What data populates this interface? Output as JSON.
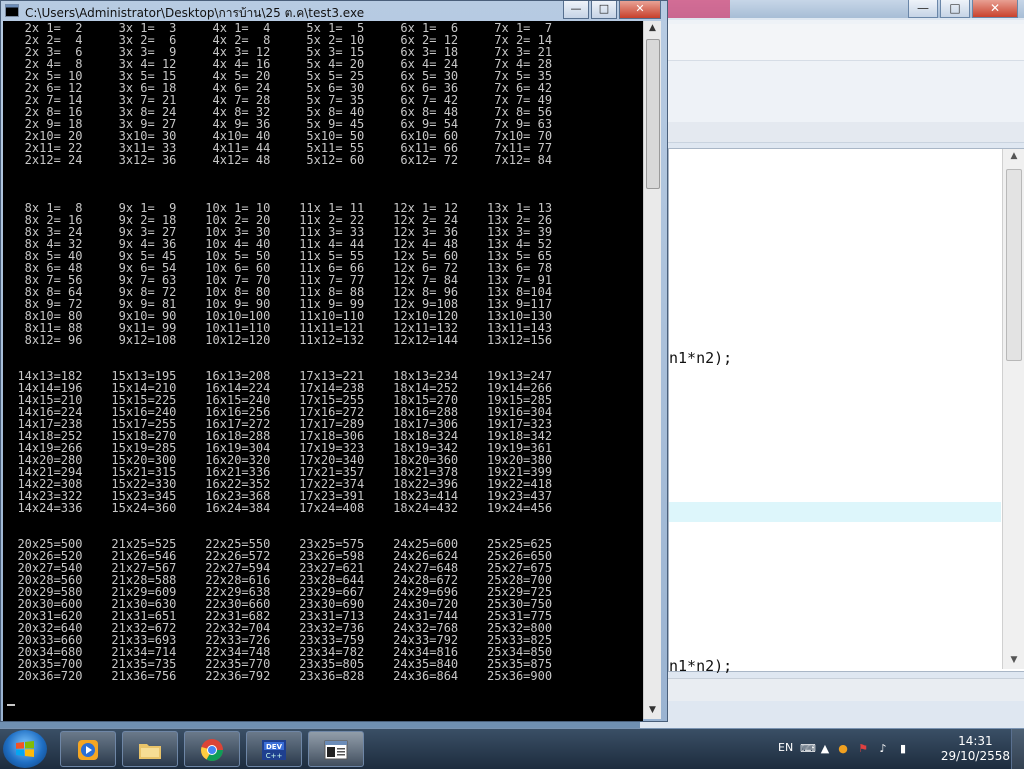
{
  "console": {
    "title": "C:\\Users\\Administrator\\Desktop\\การบ้าน\\25 ต.ค\\test3.exe",
    "controls": {
      "minimize": "—",
      "maximize": "□",
      "close": "✕"
    },
    "lines": [
      "   2x 1=  2     3x 1=  3     4x 1=  4     5x 1=  5     6x 1=  6     7x 1=  7",
      "   2x 2=  4     3x 2=  6     4x 2=  8     5x 2= 10     6x 2= 12     7x 2= 14",
      "   2x 3=  6     3x 3=  9     4x 3= 12     5x 3= 15     6x 3= 18     7x 3= 21",
      "   2x 4=  8     3x 4= 12     4x 4= 16     5x 4= 20     6x 4= 24     7x 4= 28",
      "   2x 5= 10     3x 5= 15     4x 5= 20     5x 5= 25     6x 5= 30     7x 5= 35",
      "   2x 6= 12     3x 6= 18     4x 6= 24     5x 6= 30     6x 6= 36     7x 6= 42",
      "   2x 7= 14     3x 7= 21     4x 7= 28     5x 7= 35     6x 7= 42     7x 7= 49",
      "   2x 8= 16     3x 8= 24     4x 8= 32     5x 8= 40     6x 8= 48     7x 8= 56",
      "   2x 9= 18     3x 9= 27     4x 9= 36     5x 9= 45     6x 9= 54     7x 9= 63",
      "   2x10= 20     3x10= 30     4x10= 40     5x10= 50     6x10= 60     7x10= 70",
      "   2x11= 22     3x11= 33     4x11= 44     5x11= 55     6x11= 66     7x11= 77",
      "   2x12= 24     3x12= 36     4x12= 48     5x12= 60     6x12= 72     7x12= 84",
      "",
      "",
      "",
      "   8x 1=  8     9x 1=  9    10x 1= 10    11x 1= 11    12x 1= 12    13x 1= 13",
      "   8x 2= 16     9x 2= 18    10x 2= 20    11x 2= 22    12x 2= 24    13x 2= 26",
      "   8x 3= 24     9x 3= 27    10x 3= 30    11x 3= 33    12x 3= 36    13x 3= 39",
      "   8x 4= 32     9x 4= 36    10x 4= 40    11x 4= 44    12x 4= 48    13x 4= 52",
      "   8x 5= 40     9x 5= 45    10x 5= 50    11x 5= 55    12x 5= 60    13x 5= 65",
      "   8x 6= 48     9x 6= 54    10x 6= 60    11x 6= 66    12x 6= 72    13x 6= 78",
      "   8x 7= 56     9x 7= 63    10x 7= 70    11x 7= 77    12x 7= 84    13x 7= 91",
      "   8x 8= 64     9x 8= 72    10x 8= 80    11x 8= 88    12x 8= 96    13x 8=104",
      "   8x 9= 72     9x 9= 81    10x 9= 90    11x 9= 99    12x 9=108    13x 9=117",
      "   8x10= 80     9x10= 90    10x10=100    11x10=110    12x10=120    13x10=130",
      "   8x11= 88     9x11= 99    10x11=110    11x11=121    12x11=132    13x11=143",
      "   8x12= 96     9x12=108    10x12=120    11x12=132    12x12=144    13x12=156",
      "",
      "",
      "  14x13=182    15x13=195    16x13=208    17x13=221    18x13=234    19x13=247",
      "  14x14=196    15x14=210    16x14=224    17x14=238    18x14=252    19x14=266",
      "  14x15=210    15x15=225    16x15=240    17x15=255    18x15=270    19x15=285",
      "  14x16=224    15x16=240    16x16=256    17x16=272    18x16=288    19x16=304",
      "  14x17=238    15x17=255    16x17=272    17x17=289    18x17=306    19x17=323",
      "  14x18=252    15x18=270    16x18=288    17x18=306    18x18=324    19x18=342",
      "  14x19=266    15x19=285    16x19=304    17x19=323    18x19=342    19x19=361",
      "  14x20=280    15x20=300    16x20=320    17x20=340    18x20=360    19x20=380",
      "  14x21=294    15x21=315    16x21=336    17x21=357    18x21=378    19x21=399",
      "  14x22=308    15x22=330    16x22=352    17x22=374    18x22=396    19x22=418",
      "  14x23=322    15x23=345    16x23=368    17x23=391    18x23=414    19x23=437",
      "  14x24=336    15x24=360    16x24=384    17x24=408    18x24=432    19x24=456",
      "",
      "",
      "  20x25=500    21x25=525    22x25=550    23x25=575    24x25=600    25x25=625",
      "  20x26=520    21x26=546    22x26=572    23x26=598    24x26=624    25x26=650",
      "  20x27=540    21x27=567    22x27=594    23x27=621    24x27=648    25x27=675",
      "  20x28=560    21x28=588    22x28=616    23x28=644    24x28=672    25x28=700",
      "  20x29=580    21x29=609    22x29=638    23x29=667    24x29=696    25x29=725",
      "  20x30=600    21x30=630    22x30=660    23x30=690    24x30=720    25x30=750",
      "  20x31=620    21x31=651    22x31=682    23x31=713    24x31=744    25x31=775",
      "  20x32=640    21x32=672    22x32=704    23x32=736    24x32=768    25x32=800",
      "  20x33=660    21x33=693    22x33=726    23x33=759    24x33=792    25x33=825",
      "  20x34=680    21x34=714    22x34=748    23x34=782    24x34=816    25x34=850",
      "  20x35=700    21x35=735    22x35=770    23x35=805    24x35=840    25x35=875",
      "  20x36=720    21x36=756    22x36=792    23x36=828    24x36=864    25x36=900"
    ]
  },
  "editor": {
    "controls": {
      "minimize": "—",
      "maximize": "□",
      "close": "✕"
    },
    "code_lines": [
      "n1*n2);",
      "n1*n2);"
    ]
  },
  "taskbar": {
    "apps": [
      "windows-media-player",
      "windows-explorer",
      "google-chrome",
      "dev-cpp",
      "console-test3"
    ],
    "language": "EN",
    "clock_time": "14:31",
    "clock_date": "29/10/2558"
  }
}
